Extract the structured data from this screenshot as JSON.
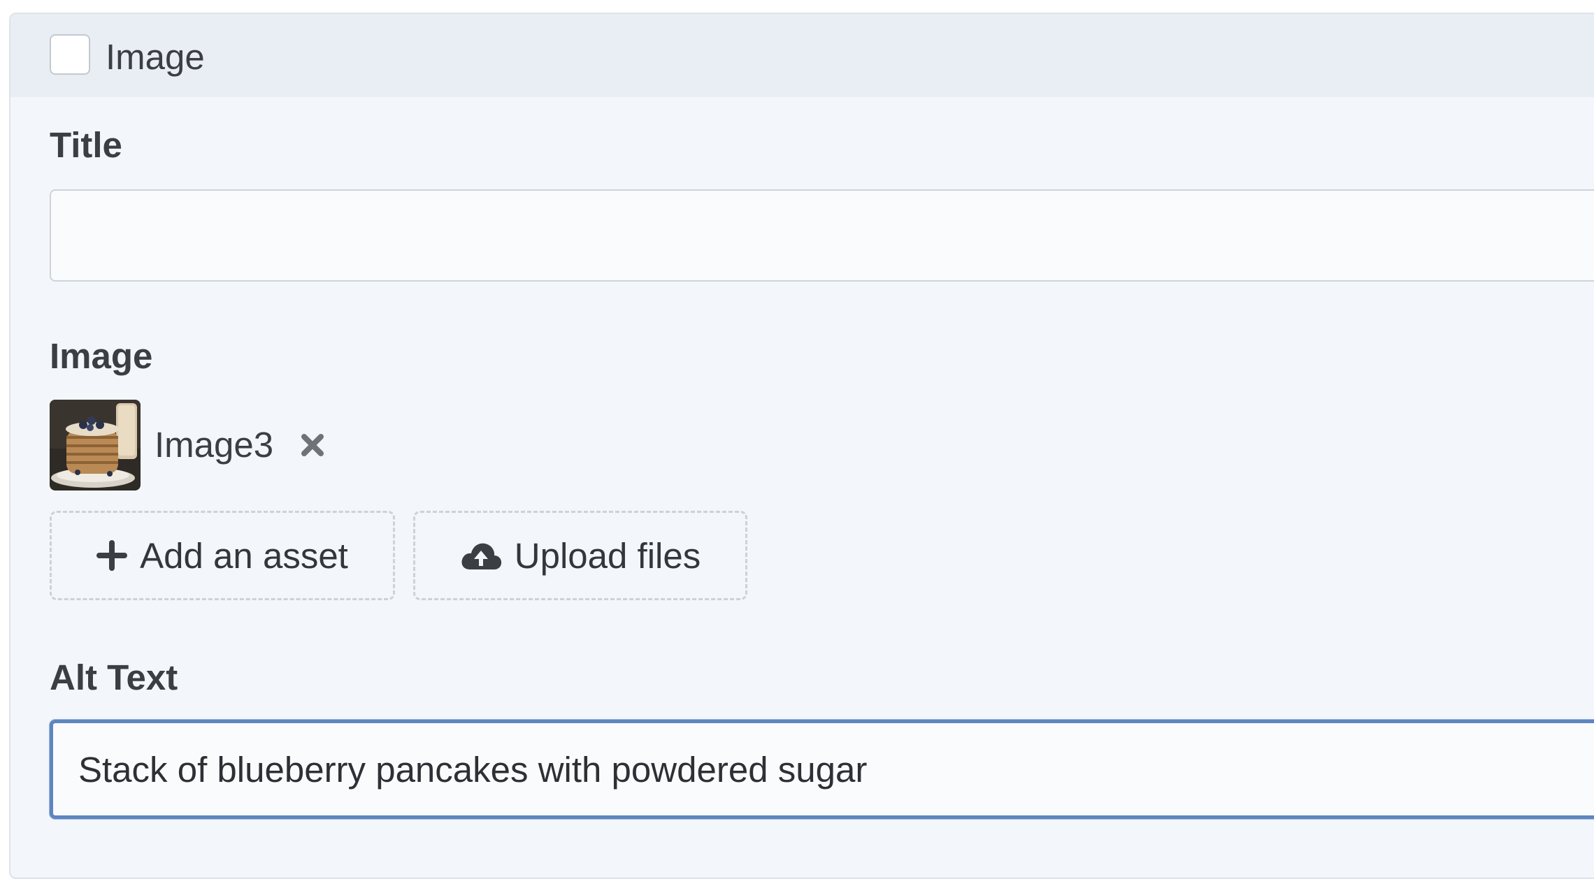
{
  "header": {
    "checkbox_checked": false,
    "label": "Image"
  },
  "title_field": {
    "label": "Title",
    "value": ""
  },
  "image_field": {
    "label": "Image",
    "asset": {
      "name": "Image3",
      "thumbnail_icon": "pancake-thumbnail"
    },
    "add_asset_label": "Add an asset",
    "add_asset_icon": "plus-icon",
    "upload_label": "Upload files",
    "upload_icon": "cloud-upload-icon",
    "remove_icon": "close-icon"
  },
  "alt_text_field": {
    "label": "Alt Text",
    "value": "Stack of blueberry pancakes with powdered sugar"
  },
  "colors": {
    "panel_bg": "#f3f6fa",
    "header_bg": "#e9eef5",
    "focus_border": "#5d86c0",
    "text": "#3b3e43"
  }
}
